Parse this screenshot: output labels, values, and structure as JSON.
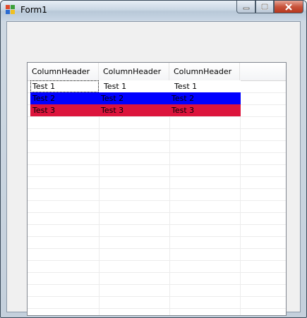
{
  "window": {
    "title": "Form1"
  },
  "listview": {
    "columns": [
      "ColumnHeader",
      "ColumnHeader",
      "ColumnHeader"
    ],
    "rows": [
      {
        "cells": [
          "Test 1",
          "Test 1",
          "Test 1"
        ],
        "background": "#ffffff",
        "color": "#000000"
      },
      {
        "cells": [
          "Test 2",
          "Test 2",
          "Test 2"
        ],
        "background": "#0000ff",
        "color": "#000000"
      },
      {
        "cells": [
          "Test 3",
          "Test 3",
          "Test 3"
        ],
        "background": "#dc143c",
        "color": "#000000"
      }
    ]
  },
  "colors": {
    "close_button": "#c8543c",
    "gridline": "#ececec"
  }
}
